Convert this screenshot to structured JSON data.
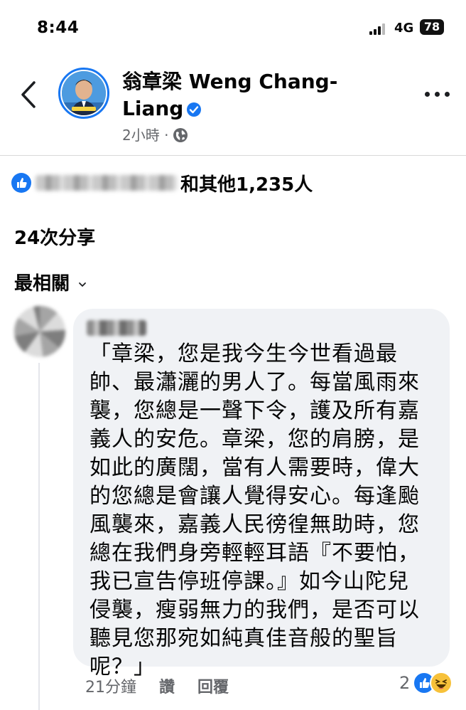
{
  "status_bar": {
    "time": "8:44",
    "network": "4G",
    "battery": "78"
  },
  "post_header": {
    "author_name": "翁章梁 Weng Chang-Liang",
    "timestamp": "2小時",
    "separator": "·",
    "privacy_icon": "globe-icon",
    "verified_icon": "verified-badge-icon"
  },
  "reactions": {
    "summary_suffix": "和其他1,235人",
    "reaction_icon": "like-icon"
  },
  "shares": {
    "label": "24次分享"
  },
  "sort": {
    "label": "最相關"
  },
  "comment": {
    "text": "「章梁，您是我今生今世看過最\n帥、最瀟灑的男人了。每當風雨來\n襲，您總是一聲下令，護及所有嘉\n義人的安危。章梁，您的肩膀，是\n如此的廣闊，當有人需要時，偉大\n的您總是會讓人覺得安心。每逢颱\n風襲來，嘉義人民徬徨無助時，您\n總在我們身旁輕輕耳語『不要怕，\n我已宣告停班停課。』如今山陀兒\n侵襲，瘦弱無力的我們，是否可以\n聽見您那宛如純真佳音般的聖旨\n呢？」",
    "time_ago": "21分鐘",
    "like_label": "讚",
    "reply_label": "回覆",
    "reaction_count": "2",
    "reaction_icons": [
      "like-icon",
      "haha-icon"
    ]
  },
  "colors": {
    "accent": "#1877f2",
    "secondary_text": "#65676b",
    "bubble": "#f0f2f5"
  }
}
